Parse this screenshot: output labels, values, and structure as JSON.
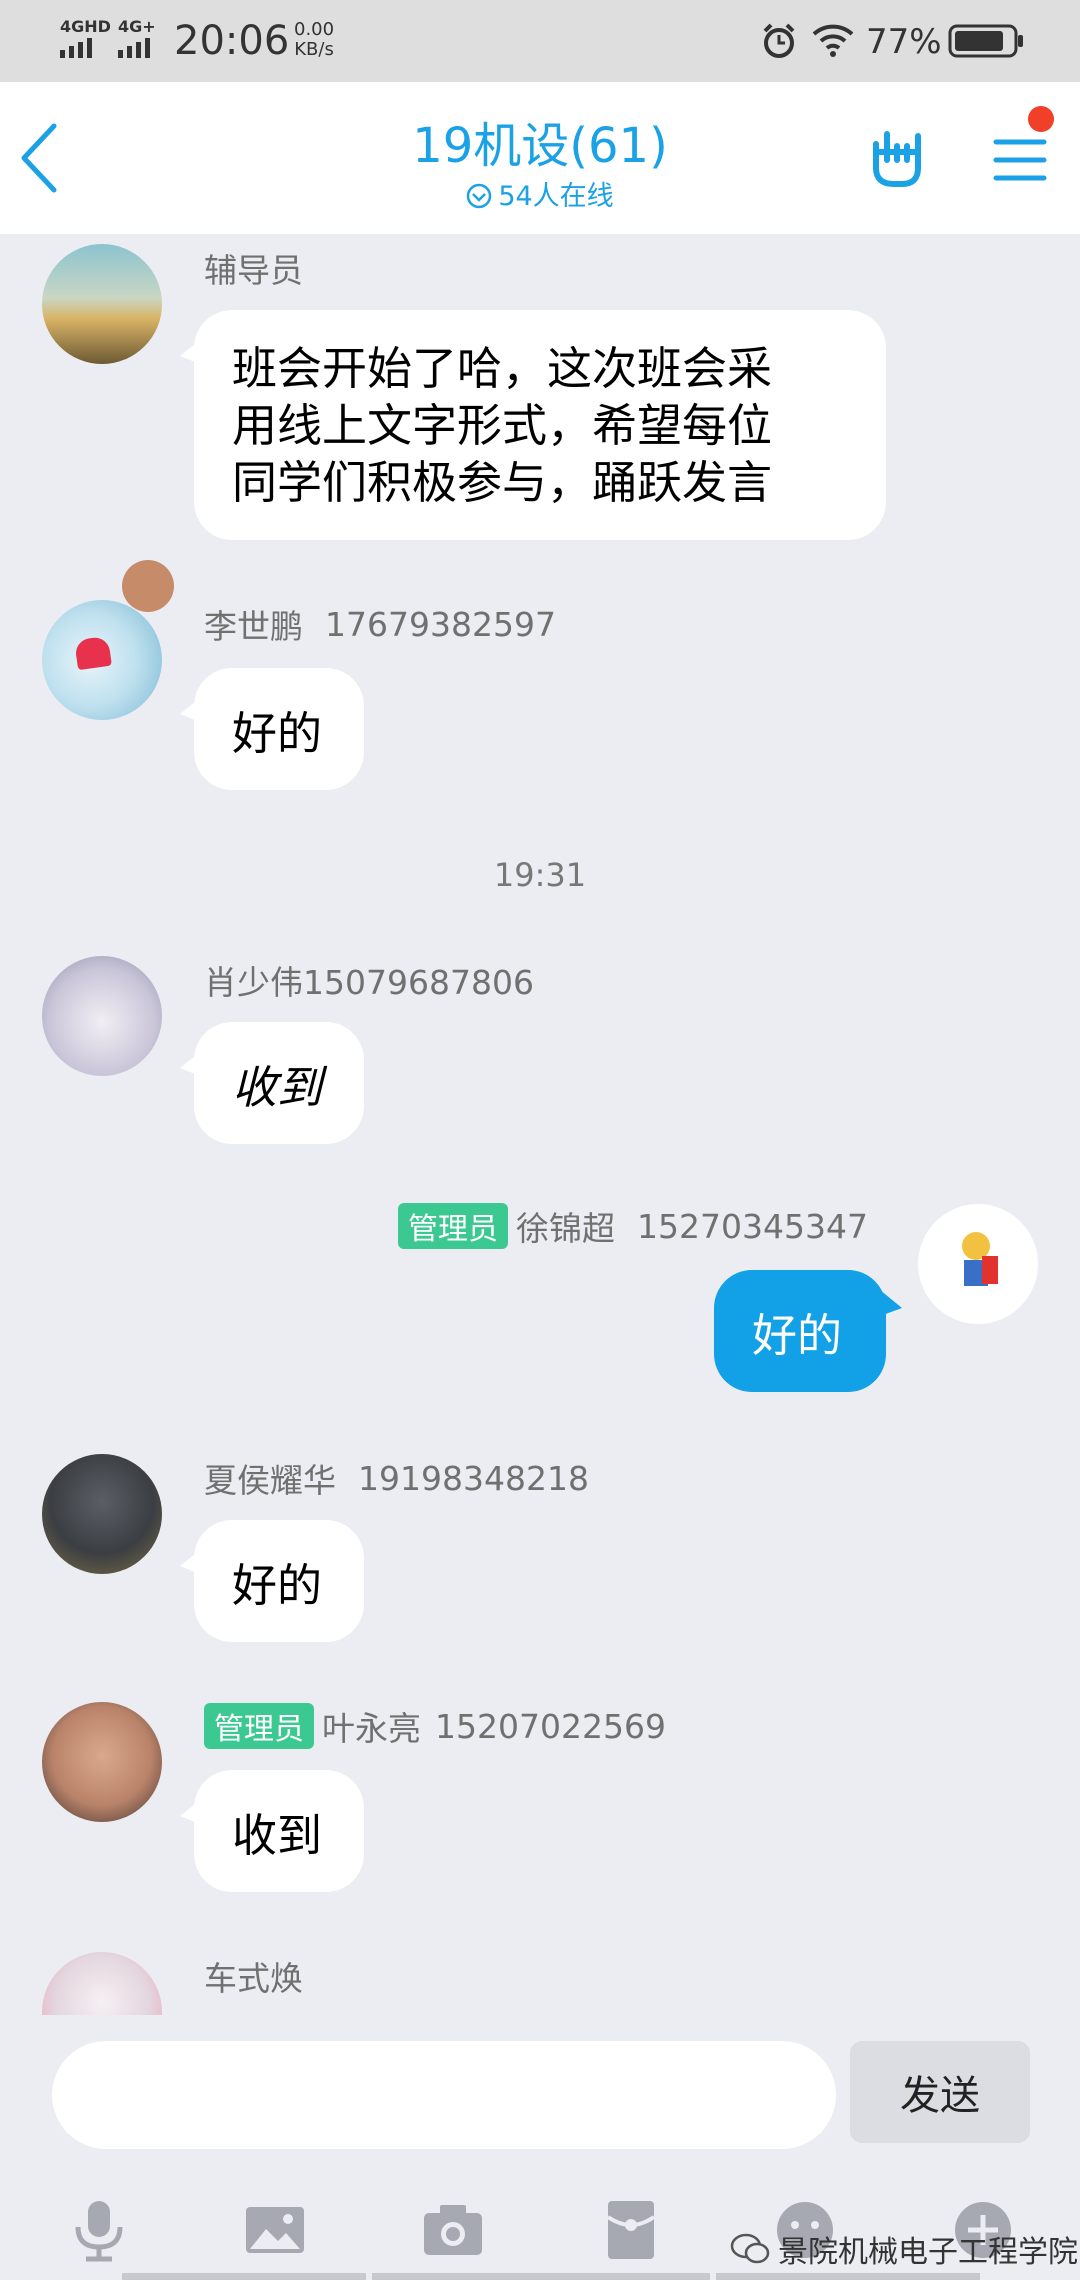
{
  "status_bar": {
    "network1": "4GHD",
    "network2": "4G+",
    "time": "20:06",
    "speed_value": "0.00",
    "speed_unit": "KB/s",
    "battery": "77%"
  },
  "header": {
    "title": "19机设(61)",
    "subtitle": "54人在线"
  },
  "messages": [
    {
      "sender": "辅导员",
      "phone": "",
      "badge": "",
      "lines": [
        "班会开始了哈，这次班会采",
        "用线上文字形式，希望每位",
        "同学们积极参与，踊跃发言"
      ]
    },
    {
      "sender": "李世鹏",
      "phone": "17679382597",
      "badge": "",
      "text": "好的"
    },
    {
      "sender": "肖少伟15079687806",
      "phone": "",
      "badge": "",
      "text": "收到"
    },
    {
      "sender": "徐锦超",
      "phone": "15270345347",
      "badge": "管理员",
      "text": "好的"
    },
    {
      "sender": "夏侯耀华",
      "phone": "19198348218",
      "badge": "",
      "text": "好的"
    },
    {
      "sender": "叶永亮",
      "phone": "15207022569",
      "badge": "管理员",
      "text": "收到"
    },
    {
      "sender": "车式焕",
      "phone": "",
      "badge": ""
    }
  ],
  "time_divider": "19:31",
  "input": {
    "placeholder": "",
    "send_label": "发送"
  },
  "watermark": "景院机械电子工程学院",
  "colors": {
    "accent": "#1AA1E6",
    "outgoing_bubble": "#12A0E6",
    "admin_badge": "#3CC891",
    "background": "#EBEDF2"
  }
}
